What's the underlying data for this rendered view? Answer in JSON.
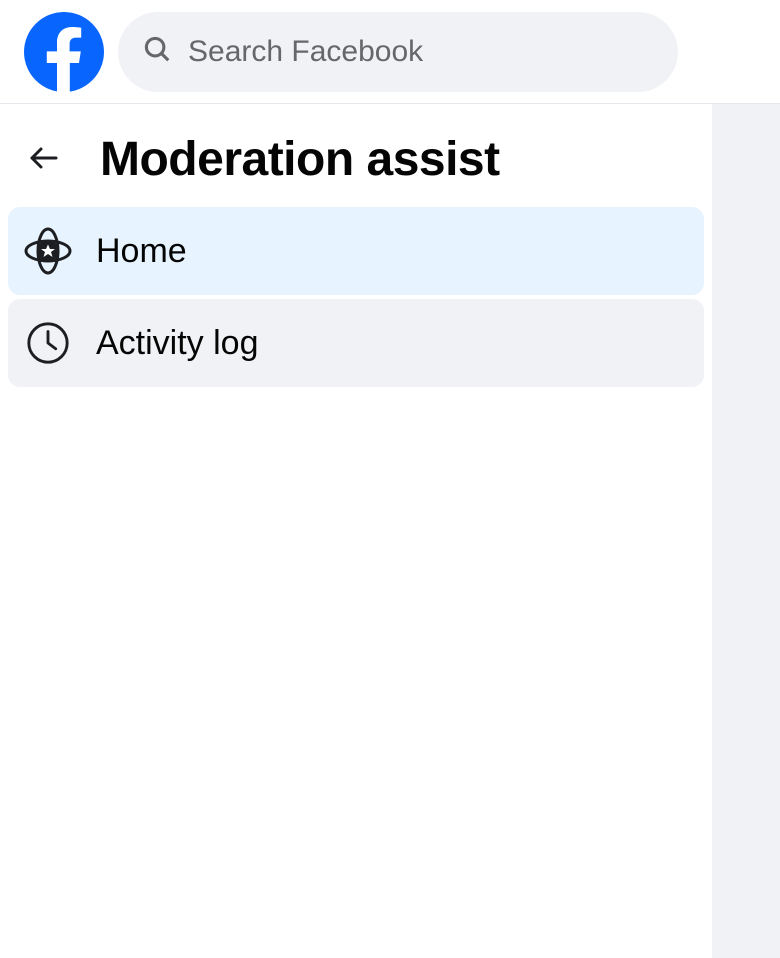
{
  "header": {
    "search_placeholder": "Search Facebook"
  },
  "page": {
    "title": "Moderation assist"
  },
  "nav": {
    "items": [
      {
        "label": "Home",
        "icon": "atom-badge",
        "active": true
      },
      {
        "label": "Activity log",
        "icon": "clock",
        "active": false
      }
    ]
  }
}
